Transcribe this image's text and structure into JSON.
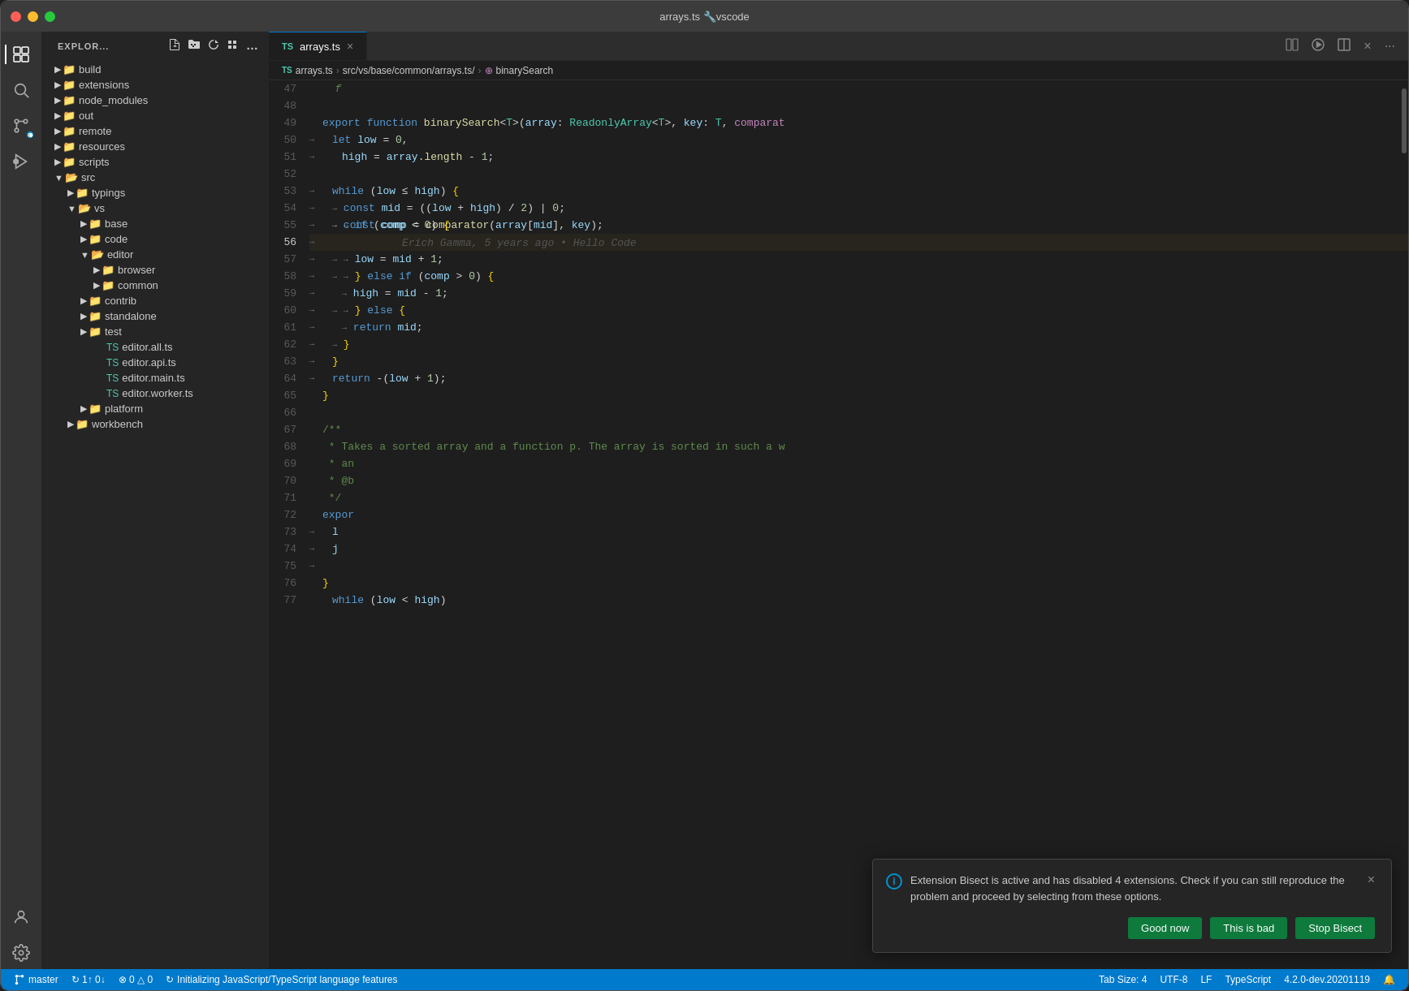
{
  "titlebar": {
    "title": "arrays.ts",
    "icon": "🔧",
    "app": "vscode"
  },
  "activitybar": {
    "icons": [
      {
        "name": "explorer-icon",
        "symbol": "⎘",
        "active": true
      },
      {
        "name": "search-icon",
        "symbol": "🔍",
        "active": false
      },
      {
        "name": "git-icon",
        "symbol": "⑂",
        "active": false
      },
      {
        "name": "debug-icon",
        "symbol": "🐛",
        "active": false
      }
    ],
    "bottom_icons": [
      {
        "name": "account-icon",
        "symbol": "👤"
      },
      {
        "name": "settings-icon",
        "symbol": "⚙"
      }
    ]
  },
  "sidebar": {
    "title": "EXPLOR...",
    "header_icons": [
      "new-file-icon",
      "new-folder-icon",
      "refresh-icon",
      "collapse-icon",
      "more-icon"
    ],
    "tree": [
      {
        "label": "build",
        "type": "dir",
        "indent": 0,
        "collapsed": true
      },
      {
        "label": "extensions",
        "type": "dir",
        "indent": 0,
        "collapsed": true
      },
      {
        "label": "node_modules",
        "type": "dir",
        "indent": 0,
        "collapsed": true
      },
      {
        "label": "out",
        "type": "dir",
        "indent": 0,
        "collapsed": true
      },
      {
        "label": "remote",
        "type": "dir",
        "indent": 0,
        "collapsed": true
      },
      {
        "label": "resources",
        "type": "dir",
        "indent": 0,
        "collapsed": true
      },
      {
        "label": "scripts",
        "type": "dir",
        "indent": 0,
        "collapsed": true
      },
      {
        "label": "src",
        "type": "dir",
        "indent": 0,
        "collapsed": false
      },
      {
        "label": "typings",
        "type": "dir",
        "indent": 1,
        "collapsed": true
      },
      {
        "label": "vs",
        "type": "dir",
        "indent": 1,
        "collapsed": false
      },
      {
        "label": "base",
        "type": "dir",
        "indent": 2,
        "collapsed": true
      },
      {
        "label": "code",
        "type": "dir",
        "indent": 2,
        "collapsed": true
      },
      {
        "label": "editor",
        "type": "dir",
        "indent": 2,
        "collapsed": false
      },
      {
        "label": "browser",
        "type": "dir",
        "indent": 3,
        "collapsed": true
      },
      {
        "label": "common",
        "type": "dir",
        "indent": 3,
        "collapsed": true
      },
      {
        "label": "contrib",
        "type": "dir",
        "indent": 2,
        "collapsed": true
      },
      {
        "label": "standalone",
        "type": "dir",
        "indent": 2,
        "collapsed": true
      },
      {
        "label": "test",
        "type": "dir",
        "indent": 2,
        "collapsed": true
      },
      {
        "label": "editor.all.ts",
        "type": "file",
        "indent": 3
      },
      {
        "label": "editor.api.ts",
        "type": "file",
        "indent": 3
      },
      {
        "label": "editor.main.ts",
        "type": "file",
        "indent": 3
      },
      {
        "label": "editor.worker.ts",
        "type": "file",
        "indent": 3
      },
      {
        "label": "platform",
        "type": "dir",
        "indent": 2,
        "collapsed": true
      },
      {
        "label": "workbench",
        "type": "dir",
        "indent": 1,
        "collapsed": true
      }
    ]
  },
  "editor": {
    "tab_title": "arrays.ts",
    "breadcrumb": "src/vs/base/common/arrays.ts/ binarySearch",
    "lines": [
      {
        "num": 47,
        "code": ""
      },
      {
        "num": 48,
        "code": ""
      },
      {
        "num": 49,
        "code": "export function binarySearch<T>(array: ReadonlyArray<T>, key: T, comparat"
      },
      {
        "num": 50,
        "code": "  let low = 0,"
      },
      {
        "num": 51,
        "code": "    high = array.length - 1;"
      },
      {
        "num": 52,
        "code": ""
      },
      {
        "num": 53,
        "code": "  while (low ≤ high) {"
      },
      {
        "num": 54,
        "code": "    const mid = ((low + high) / 2) | 0;"
      },
      {
        "num": 55,
        "code": "    const comp = comparator(array[mid], key);"
      },
      {
        "num": 56,
        "code": "  if (comp < 0) {"
      },
      {
        "num": 57,
        "code": "      low = mid + 1;"
      },
      {
        "num": 58,
        "code": "    } else if (comp > 0) {"
      },
      {
        "num": 59,
        "code": "      high = mid - 1;"
      },
      {
        "num": 60,
        "code": "    } else {"
      },
      {
        "num": 61,
        "code": "      return mid;"
      },
      {
        "num": 62,
        "code": "    }"
      },
      {
        "num": 63,
        "code": "  }"
      },
      {
        "num": 64,
        "code": "  return -(low + 1);"
      },
      {
        "num": 65,
        "code": "}"
      },
      {
        "num": 66,
        "code": ""
      },
      {
        "num": 67,
        "code": "/**"
      },
      {
        "num": 68,
        "code": " * Takes a sorted array and a function p. The array is sorted in such a w"
      },
      {
        "num": 69,
        "code": " * an"
      },
      {
        "num": 70,
        "code": " * @b"
      },
      {
        "num": 71,
        "code": " */"
      },
      {
        "num": 72,
        "code": "expor"
      },
      {
        "num": 73,
        "code": "  →  l"
      },
      {
        "num": 74,
        "code": "  →  j"
      },
      {
        "num": 75,
        "code": "  →  "
      },
      {
        "num": 76,
        "code": "}"
      },
      {
        "num": 77,
        "code": "  while (low < high)"
      }
    ],
    "ghost_annotation": "Erich Gamma, 5 years ago • Hello Code"
  },
  "notification": {
    "message": "Extension Bisect is active and has disabled 4 extensions. Check if you can still reproduce the problem and proceed by selecting from these options.",
    "buttons": [
      {
        "label": "Good now",
        "name": "good-now-button"
      },
      {
        "label": "This is bad",
        "name": "this-is-bad-button"
      },
      {
        "label": "Stop Bisect",
        "name": "stop-bisect-button"
      }
    ],
    "close_label": "×"
  },
  "statusbar": {
    "left_items": [
      {
        "label": "⎇ master",
        "name": "git-branch"
      },
      {
        "label": "↻ 1↑ 0↓",
        "name": "git-sync"
      },
      {
        "label": "⊗ 0 △ 0",
        "name": "errors-warnings"
      },
      {
        "label": "↻ Initializing JavaScript/TypeScript language features",
        "name": "language-status"
      }
    ],
    "right_items": [
      {
        "label": "Tab Size: 4",
        "name": "tab-size"
      },
      {
        "label": "UTF-8",
        "name": "encoding"
      },
      {
        "label": "LF",
        "name": "line-endings"
      },
      {
        "label": "TypeScript",
        "name": "language-mode"
      },
      {
        "label": "4.2.0-dev.20201119",
        "name": "ts-version"
      },
      {
        "label": "🔔",
        "name": "notifications"
      }
    ]
  }
}
